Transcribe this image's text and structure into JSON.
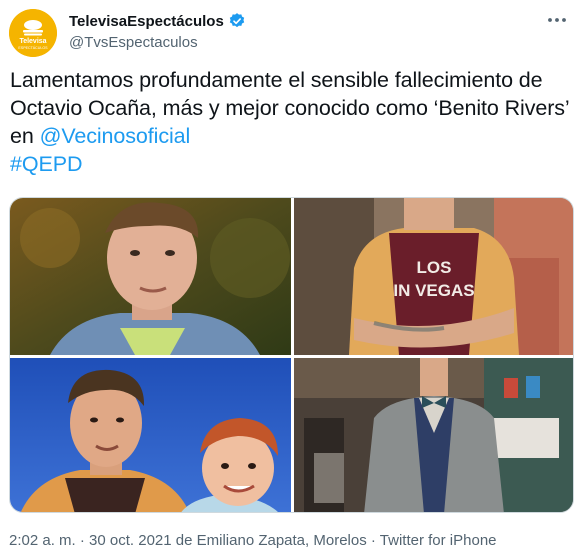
{
  "account": {
    "display_name": "TelevisaEspectáculos",
    "handle": "@TvsEspectaculos",
    "avatar_logo_text": "Televisa",
    "avatar_logo_subtext": "ESPECTÁCULOS"
  },
  "tweet": {
    "text_before": "Lamentamos profundamente el sensible fallecimiento de Octavio Ocaña, más y mejor conocido como ‘Benito Rivers’ en ",
    "mention": "@Vecinosoficial",
    "hashtag": "#QEPD"
  },
  "media": {
    "photo2_shirt_text_line1": "LOS",
    "photo2_shirt_text_line2": "IN VEGAS"
  },
  "footer": {
    "time": "2:02 a. m.",
    "sep1": " · ",
    "date": "30 oct. 2021 de Emiliano Zapata, Morelos",
    "sep2": " · ",
    "source": "Twitter for iPhone"
  },
  "colors": {
    "link": "#1d9bf0",
    "verified": "#1d9bf0",
    "avatar_bg": "#f5b400"
  }
}
